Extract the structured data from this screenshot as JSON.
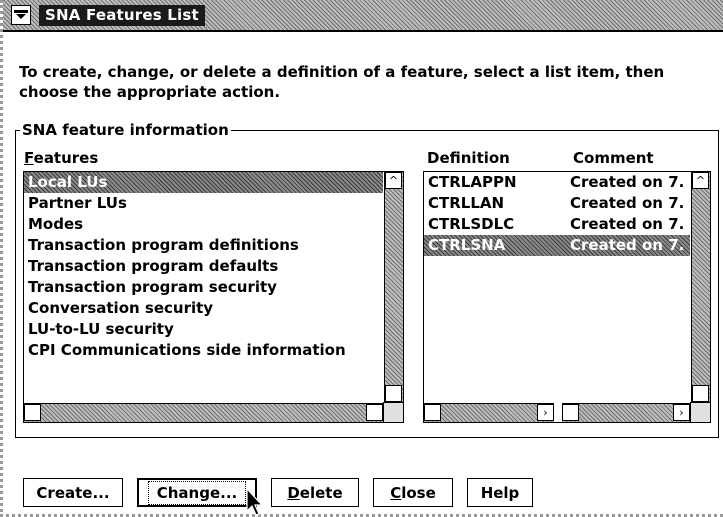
{
  "window": {
    "title": "SNA Features List"
  },
  "instructions": "To create, change, or delete a definition of a feature, select a list item, then choose the appropriate action.",
  "group": {
    "label": "SNA feature information"
  },
  "features": {
    "header_mnemonic": "F",
    "header_rest": "eatures",
    "items": [
      {
        "label": "Local LUs",
        "selected": true
      },
      {
        "label": "Partner LUs",
        "selected": false
      },
      {
        "label": "Modes",
        "selected": false
      },
      {
        "label": "Transaction program definitions",
        "selected": false
      },
      {
        "label": "Transaction program defaults",
        "selected": false
      },
      {
        "label": "Transaction program security",
        "selected": false
      },
      {
        "label": "Conversation security",
        "selected": false
      },
      {
        "label": "LU-to-LU security",
        "selected": false
      },
      {
        "label": "CPI Communications side information",
        "selected": false
      }
    ]
  },
  "definitions": {
    "col_definition": "Definition",
    "col_comment": "Comment",
    "rows": [
      {
        "definition": "CTRLAPPN",
        "comment": "Created on 7.",
        "selected": false
      },
      {
        "definition": "CTRLLAN",
        "comment": "Created on 7.",
        "selected": false
      },
      {
        "definition": "CTRLSDLC",
        "comment": "Created on 7.",
        "selected": false
      },
      {
        "definition": "CTRLSNA",
        "comment": "Created on 7.",
        "selected": true
      }
    ]
  },
  "buttons": {
    "create": "Create...",
    "change": "Change...",
    "delete_mnemonic": "D",
    "delete_rest": "elete",
    "close_mnemonic": "C",
    "close_rest": "lose",
    "help": "Help"
  }
}
